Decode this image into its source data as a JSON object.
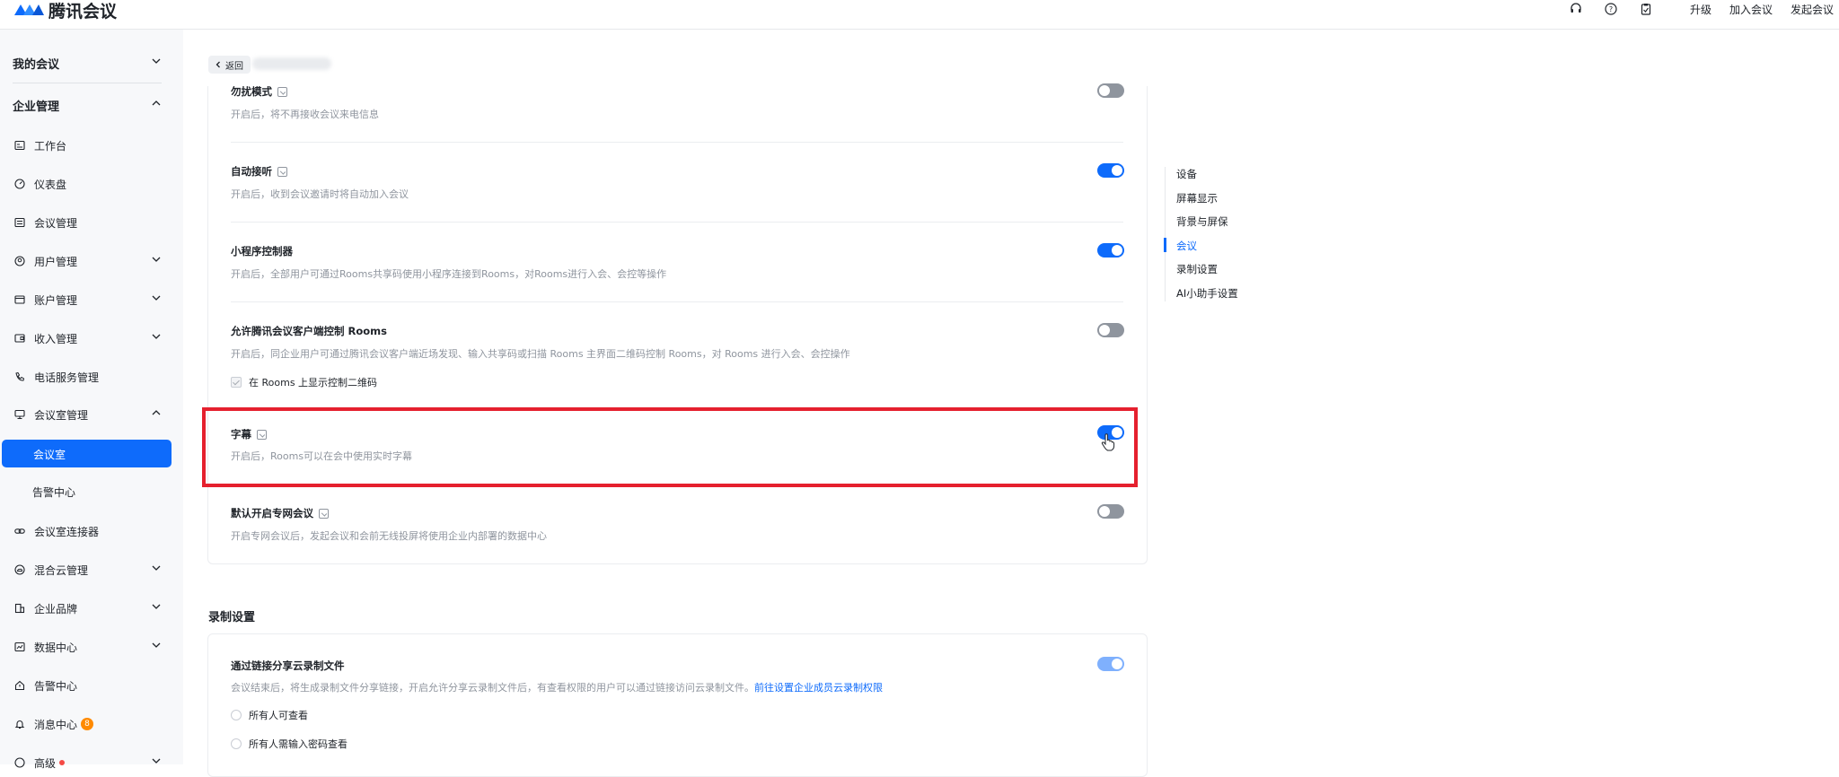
{
  "app": {
    "name": "腾讯会议",
    "brand_color": "#0e6bfb"
  },
  "topbar": {
    "icons": [
      "headset-icon",
      "help-icon",
      "clipboard-icon"
    ],
    "links": [
      "升级",
      "加入会议",
      "发起会议"
    ]
  },
  "sidebar": {
    "my_meetings": "我的会议",
    "enterprise": "企业管理",
    "items": {
      "workbench": "工作台",
      "dashboard": "仪表盘",
      "meeting_mgmt": "会议管理",
      "user_mgmt": "用户管理",
      "account_mgmt": "账户管理",
      "income_mgmt": "收入管理",
      "phone_service": "电话服务管理",
      "room_mgmt": "会议室管理",
      "room": "会议室",
      "alert_center_sub": "告警中心",
      "room_connector": "会议室连接器",
      "hybrid_cloud": "混合云管理",
      "brand": "企业品牌",
      "data_center": "数据中心",
      "alert_center": "告警中心",
      "message_center": "消息中心",
      "message_badge": "8",
      "advanced": "高级"
    }
  },
  "breadcrumb": {
    "back": "返回"
  },
  "settings": [
    {
      "title": "勿扰模式",
      "desc": "开启后，将不再接收会议来电信息",
      "state": "off"
    },
    {
      "title": "自动接听",
      "desc": "开启后，收到会议邀请时将自动加入会议",
      "state": "on"
    },
    {
      "title": "小程序控制器",
      "desc": "开启后，全部用户可通过Rooms共享码使用小程序连接到Rooms，对Rooms进行入会、会控等操作",
      "state": "on"
    },
    {
      "title": "允许腾讯会议客户端控制 Rooms",
      "desc": "开启后，同企业用户可通过腾讯会议客户端近场发现、输入共享码或扫描 Rooms 主界面二维码控制 Rooms，对 Rooms 进行入会、会控操作",
      "state": "off",
      "checkbox": "在 Rooms 上显示控制二维码"
    },
    {
      "title": "字幕",
      "desc": "开启后，Rooms可以在会中使用实时字幕",
      "state": "on"
    },
    {
      "title": "默认开启专网会议",
      "desc": "开启专网会议后，发起会议和会前无线投屏将使用企业内部署的数据中心",
      "state": "off"
    }
  ],
  "recording": {
    "section_title": "录制设置",
    "share_title": "通过链接分享云录制文件",
    "share_desc": "会议结束后，将生成录制文件分享链接，开启允许分享云录制文件后，有查看权限的用户可以通过链接访问云录制文件。",
    "share_link": "前往设置企业成员云录制权限",
    "options": [
      "所有人可查看",
      "所有人需输入密码查看"
    ]
  },
  "anchor_nav": {
    "items": [
      "设备",
      "屏幕显示",
      "背景与屏保",
      "会议",
      "录制设置",
      "AI小助手设置"
    ],
    "active": "会议"
  }
}
